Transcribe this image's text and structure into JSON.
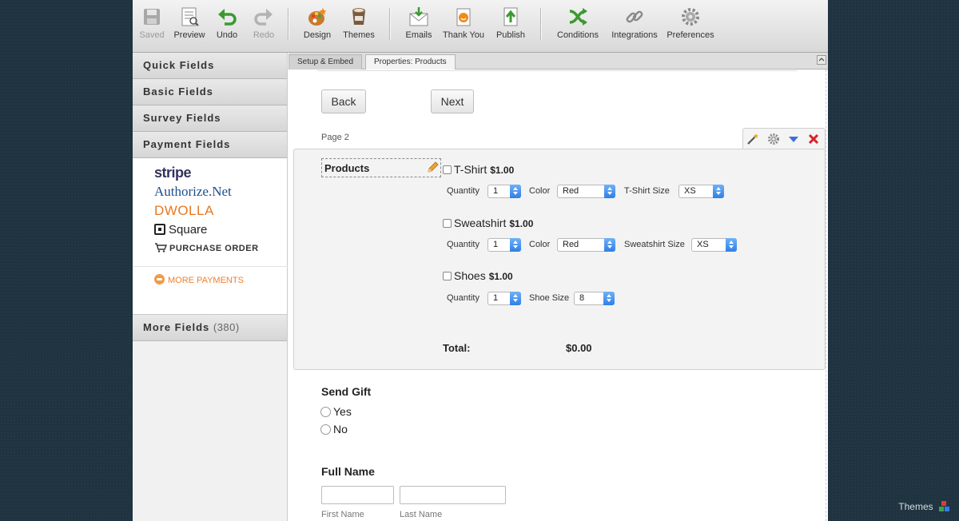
{
  "toolbar": {
    "items": [
      {
        "label": "Saved",
        "icon": "save-icon",
        "disabled": true
      },
      {
        "label": "Preview",
        "icon": "preview-icon"
      },
      {
        "label": "Undo",
        "icon": "undo-icon"
      },
      {
        "label": "Redo",
        "icon": "redo-icon",
        "disabled": true
      },
      {
        "label": "Design",
        "icon": "design-palette-icon"
      },
      {
        "label": "Themes",
        "icon": "themes-icon"
      },
      {
        "label": "Emails",
        "icon": "emails-icon"
      },
      {
        "label": "Thank You",
        "icon": "thank-you-icon"
      },
      {
        "label": "Publish",
        "icon": "publish-icon"
      },
      {
        "label": "Conditions",
        "icon": "conditions-icon"
      },
      {
        "label": "Integrations",
        "icon": "integrations-icon"
      },
      {
        "label": "Preferences",
        "icon": "preferences-gear-icon"
      }
    ]
  },
  "sidebar": {
    "categories": {
      "quick": "Quick Fields",
      "basic": "Basic Fields",
      "survey": "Survey Fields",
      "payment": "Payment Fields",
      "more": "More Fields",
      "more_count": "(380)"
    },
    "payment_gateways": {
      "stripe": "stripe",
      "authorize_net": "Authorize.Net",
      "dwolla": "DWOLLA",
      "square": "Square",
      "purchase_order": "PURCHASE ORDER"
    },
    "more_payments": "MORE PAYMENTS"
  },
  "tabs": {
    "setup": "Setup & Embed",
    "properties": "Properties: Products"
  },
  "form": {
    "back_label": "Back",
    "next_label": "Next",
    "page_label": "Page 2",
    "products_label": "Products",
    "products": [
      {
        "name": "T-Shirt",
        "price": "$1.00",
        "qty_label": "Quantity",
        "qty": "1",
        "color_label": "Color",
        "color": "Red",
        "size_label": "T-Shirt Size",
        "size": "XS"
      },
      {
        "name": "Sweatshirt",
        "price": "$1.00",
        "qty_label": "Quantity",
        "qty": "1",
        "color_label": "Color",
        "color": "Red",
        "size_label": "Sweatshirt Size",
        "size": "XS"
      },
      {
        "name": "Shoes",
        "price": "$1.00",
        "qty_label": "Quantity",
        "qty": "1",
        "size_label": "Shoe Size",
        "size": "8"
      }
    ],
    "total_label": "Total:",
    "total_value": "$0.00",
    "send_gift": {
      "title": "Send Gift",
      "options": [
        "Yes",
        "No"
      ]
    },
    "full_name": {
      "title": "Full Name",
      "first_label": "First Name",
      "last_label": "Last Name"
    }
  },
  "corner": {
    "themes_label": "Themes"
  },
  "colors": {
    "toolbar_bg": "#dcdcdc",
    "accent_blue": "#2f7fe8",
    "orange": "#f08030",
    "background": "#1f3340"
  }
}
